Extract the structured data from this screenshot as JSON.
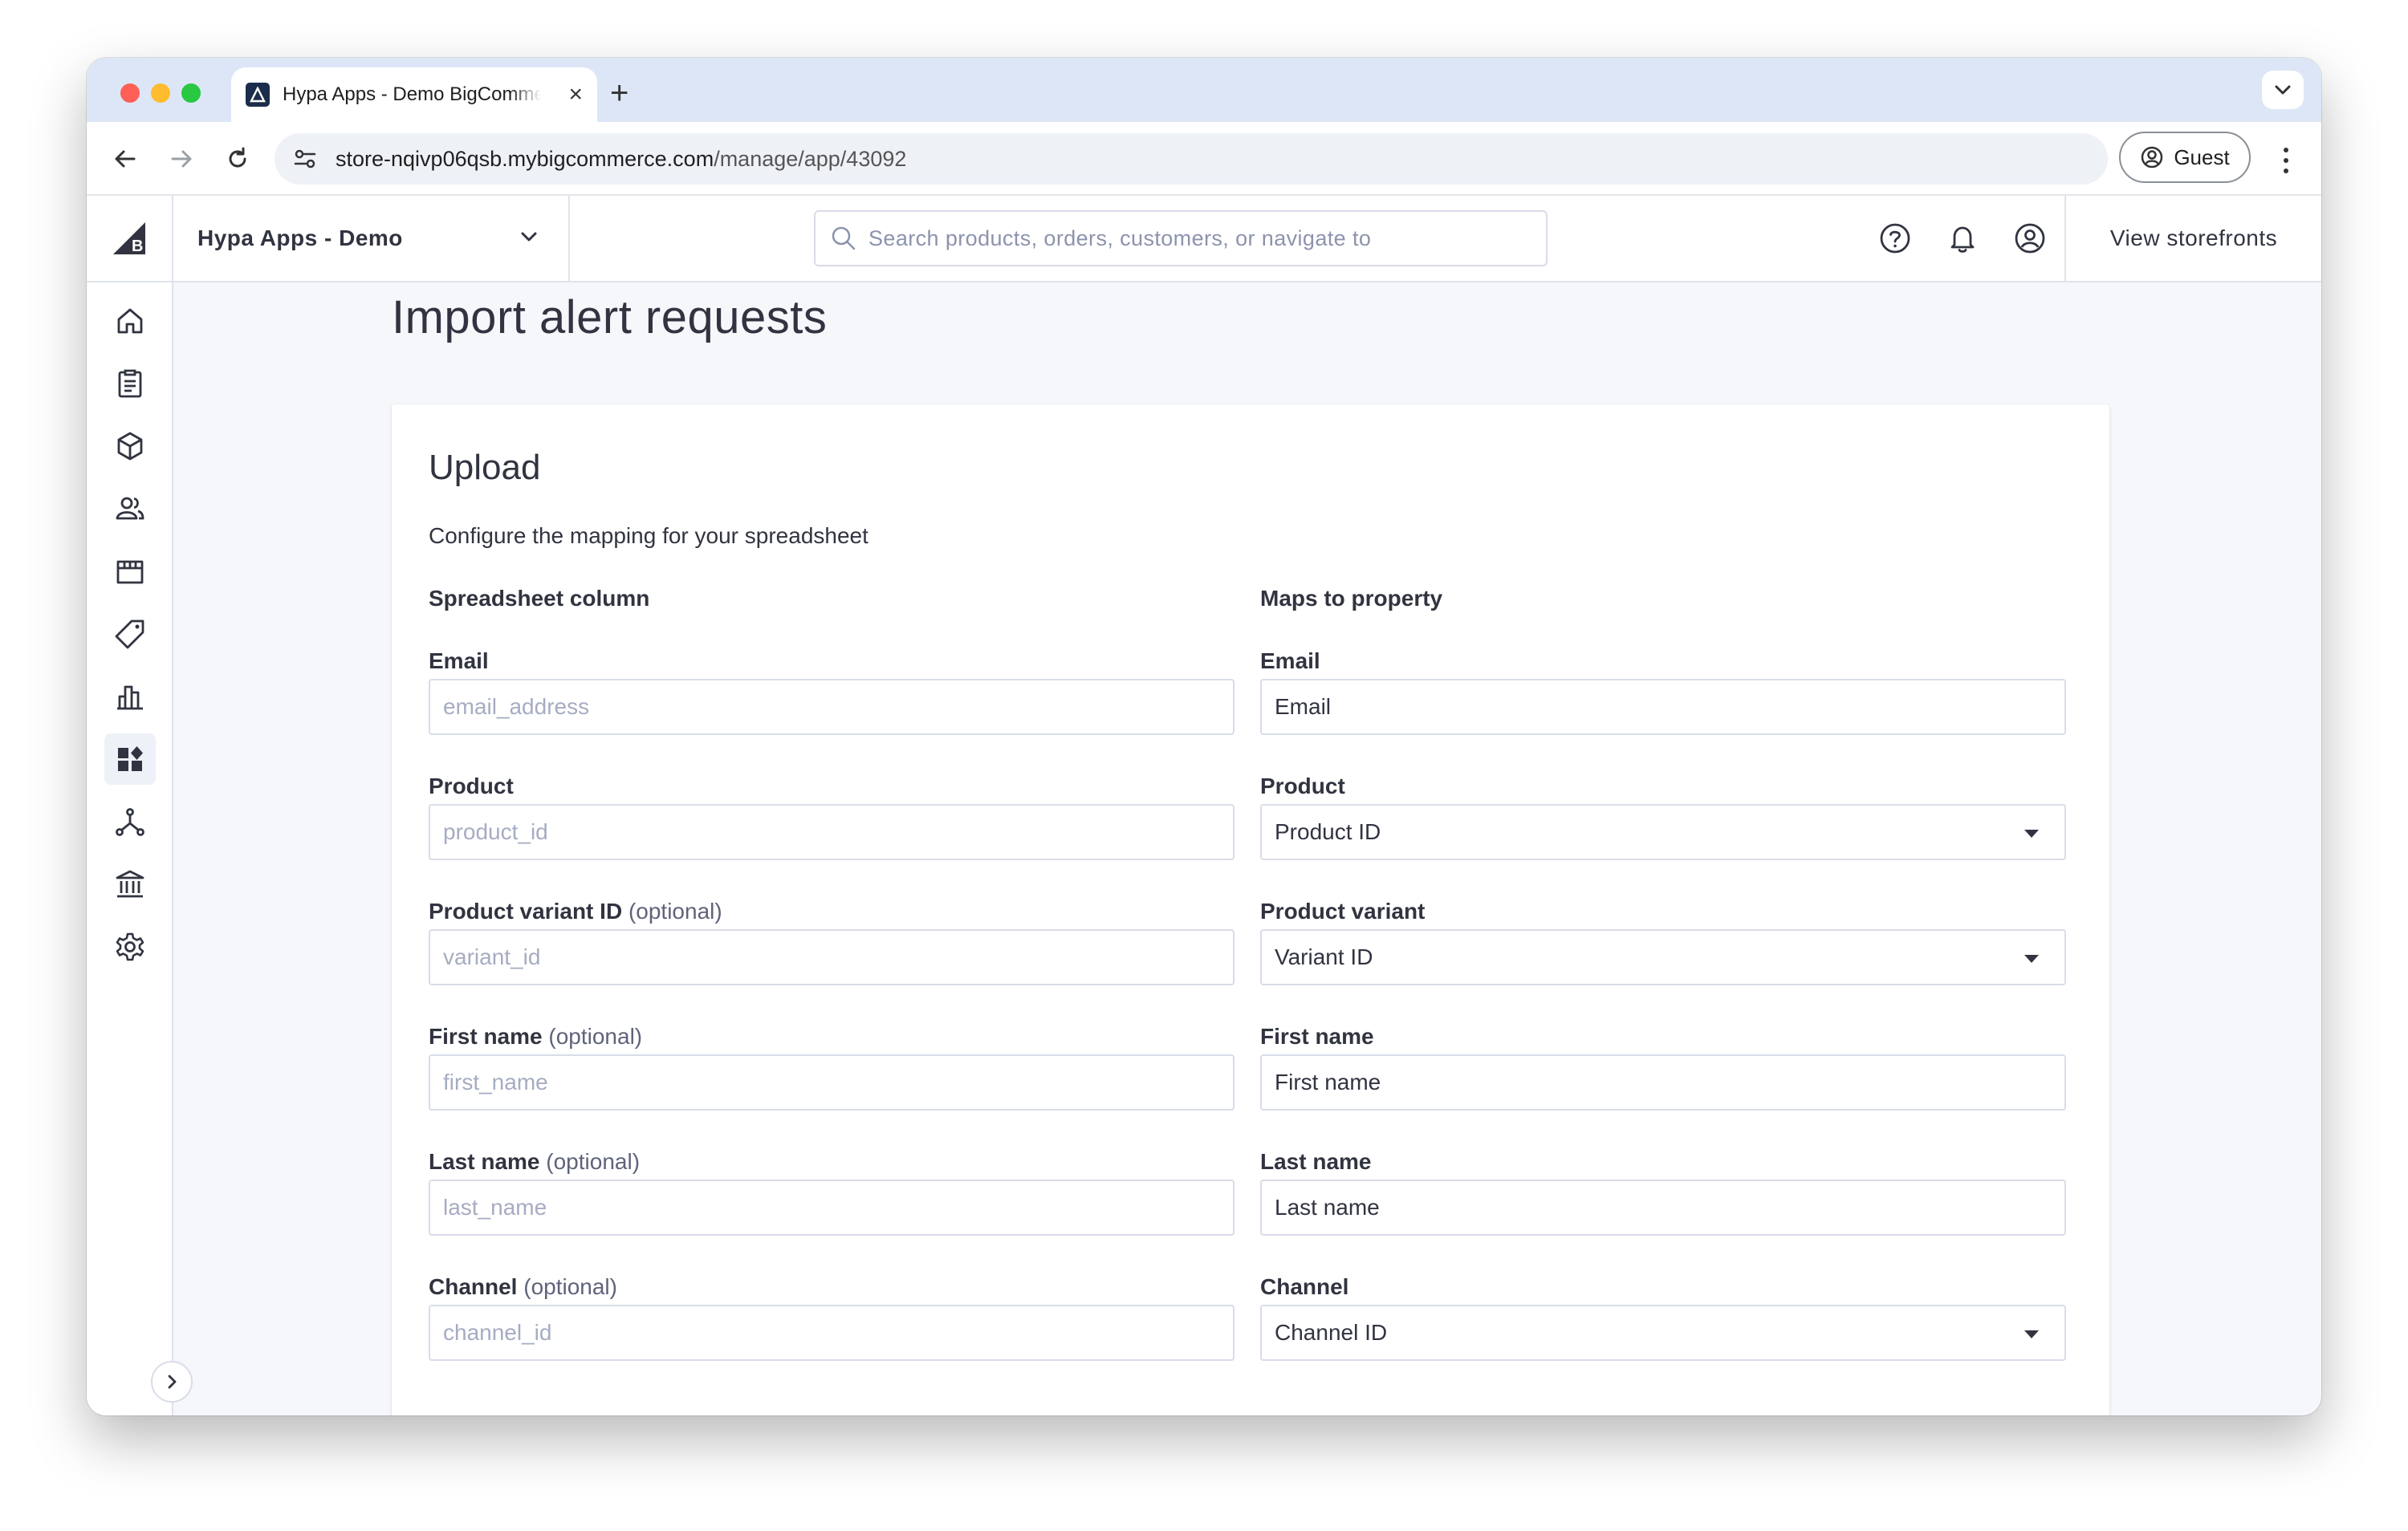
{
  "browser": {
    "tab_title": "Hypa Apps - Demo BigCommerce",
    "tab_close": "×",
    "new_tab": "+",
    "url_host": "store-nqivp06qsb.mybigcommerce.com",
    "url_path": "/manage/app/43092",
    "profile_label": "Guest"
  },
  "header": {
    "store_name": "Hypa Apps - Demo",
    "search_placeholder": "Search products, orders, customers, or navigate to",
    "view_storefronts": "View storefronts"
  },
  "sidebar": {
    "items": [
      {
        "icon": "home-icon"
      },
      {
        "icon": "orders-icon"
      },
      {
        "icon": "products-icon"
      },
      {
        "icon": "customers-icon"
      },
      {
        "icon": "storefront-icon"
      },
      {
        "icon": "marketing-icon"
      },
      {
        "icon": "analytics-icon"
      },
      {
        "icon": "apps-icon",
        "active": true
      },
      {
        "icon": "channels-icon"
      },
      {
        "icon": "finance-icon"
      },
      {
        "icon": "settings-icon"
      }
    ]
  },
  "page": {
    "title": "Import alert requests",
    "panel_title": "Upload",
    "description": "Configure the mapping for your spreadsheet",
    "col_left": "Spreadsheet column",
    "col_right": "Maps to property",
    "rows": [
      {
        "label": "Email",
        "optional": "",
        "placeholder": "email_address",
        "map_label": "Email",
        "map_value": "Email",
        "select": false
      },
      {
        "label": "Product",
        "optional": "",
        "placeholder": "product_id",
        "map_label": "Product",
        "map_value": "Product ID",
        "select": true
      },
      {
        "label": "Product variant ID",
        "optional": "(optional)",
        "placeholder": "variant_id",
        "map_label": "Product variant",
        "map_value": "Variant ID",
        "select": true
      },
      {
        "label": "First name",
        "optional": "(optional)",
        "placeholder": "first_name",
        "map_label": "First name",
        "map_value": "First name",
        "select": false
      },
      {
        "label": "Last name",
        "optional": "(optional)",
        "placeholder": "last_name",
        "map_label": "Last name",
        "map_value": "Last name",
        "select": false
      },
      {
        "label": "Channel",
        "optional": "(optional)",
        "placeholder": "channel_id",
        "map_label": "Channel",
        "map_value": "Channel ID",
        "select": true
      }
    ]
  }
}
